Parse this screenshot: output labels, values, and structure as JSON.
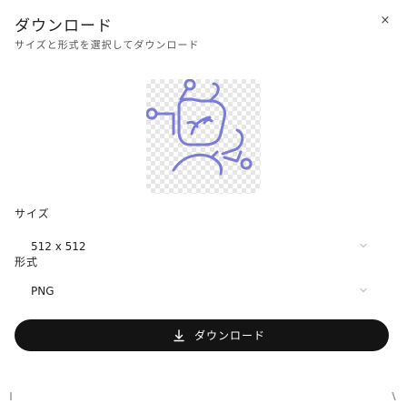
{
  "dialog": {
    "title": "ダウンロード",
    "subtitle": "サイズと形式を選択してダウンロード",
    "close_icon": "×"
  },
  "size": {
    "label": "サイズ",
    "value": "512 x 512"
  },
  "format": {
    "label": "形式",
    "value": "PNG"
  },
  "download": {
    "label": "ダウンロード"
  },
  "icons": {
    "close": "close-icon",
    "chevron": "chevron-down-icon",
    "download": "download-icon",
    "preview": "eco-recycle-icon"
  }
}
